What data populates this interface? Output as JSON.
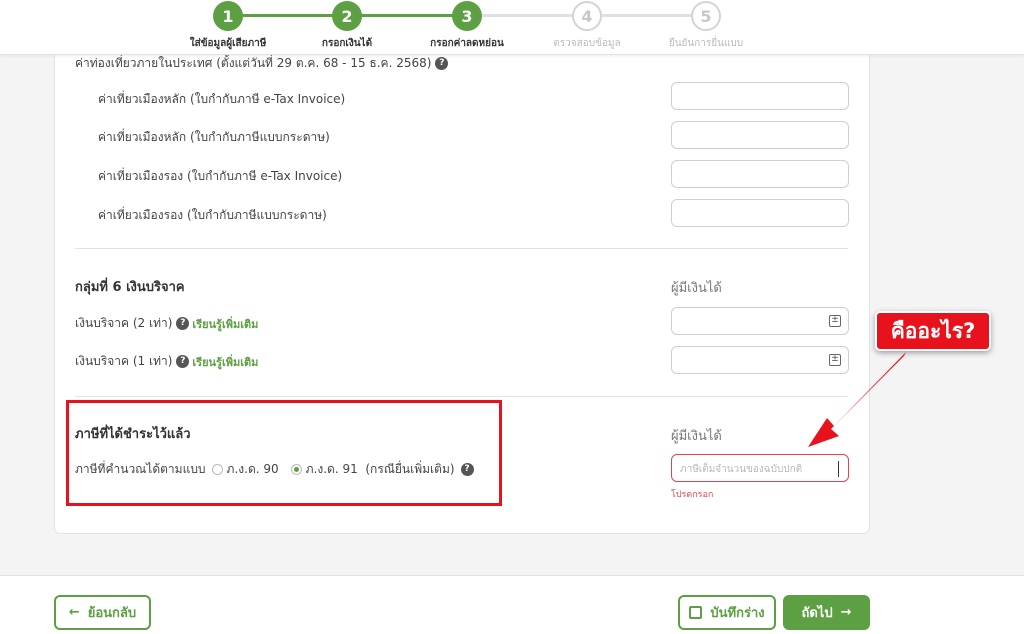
{
  "stepper": {
    "steps": [
      {
        "num": "1",
        "label": "ใส่ข้อมูลผู้เสียภาษี",
        "state": "done"
      },
      {
        "num": "2",
        "label": "กรอกเงินได้",
        "state": "done"
      },
      {
        "num": "3",
        "label": "กรอกค่าลดหย่อน",
        "state": "done"
      },
      {
        "num": "4",
        "label": "ตรวจสอบข้อมูล",
        "state": "todo"
      },
      {
        "num": "5",
        "label": "ยืนยันการยื่นแบบ",
        "state": "todo"
      }
    ]
  },
  "travel": {
    "heading": "ค่าท่องเที่ยวภายในประเทศ (ตั้งแต่วันที่ 29 ต.ค. 68 - 15 ธ.ค. 2568)",
    "help": "?",
    "rows": [
      "ค่าเที่ยวเมืองหลัก (ใบกำกับภาษี e-Tax Invoice)",
      "ค่าเที่ยวเมืองหลัก (ใบกำกับภาษีแบบกระดาษ)",
      "ค่าเที่ยวเมืองรอง (ใบกำกับภาษี e-Tax Invoice)",
      "ค่าเที่ยวเมืองรอง (ใบกำกับภาษีแบบกระดาษ)"
    ]
  },
  "donation": {
    "title": "กลุ่มที่ 6 เงินบริจาค",
    "column": "ผู้มีเงินได้",
    "rows": [
      {
        "label": "เงินบริจาค (2 เท่า)",
        "help": "?",
        "link": "เรียนรู้เพิ่มเติม"
      },
      {
        "label": "เงินบริจาค (1 เท่า)",
        "help": "?",
        "link": "เรียนรู้เพิ่มเติม"
      }
    ],
    "calc_icon": "±"
  },
  "tax_paid": {
    "title": "ภาษีที่ได้ชำระไว้แล้ว",
    "column": "ผู้มีเงินได้",
    "label": "ภาษีที่คำนวณได้ตามแบบ",
    "option1": "ภ.ง.ด. 90",
    "option2": "ภ.ง.ด. 91",
    "note": "(กรณียื่นเพิ่มเติม)",
    "help": "?",
    "placeholder": "ภาษีเต็มจำนวนของฉบับปกติ",
    "error": "โปรดกรอก"
  },
  "annotation": {
    "callout": "คืออะไร?",
    "color": "#e8121c"
  },
  "footer": {
    "back": "ย้อนกลับ",
    "save": "บันทึกร่าง",
    "next": "ถัดไป"
  },
  "colors": {
    "accent": "#5da043",
    "error": "#e0454f"
  }
}
